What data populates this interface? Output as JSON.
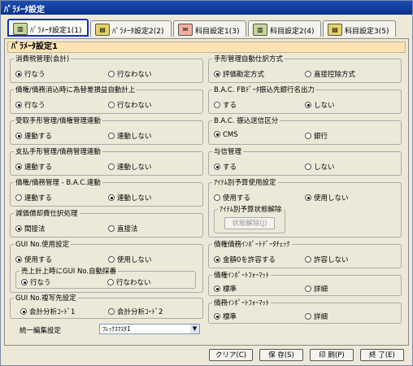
{
  "window": {
    "title": "ﾊﾟﾗﾒｰﾀ設定"
  },
  "tabs": [
    {
      "label": "ﾊﾟﾗﾒｰﾀ設定1(1)",
      "icon": "book-icon",
      "active": true
    },
    {
      "label": "ﾊﾟﾗﾒｰﾀ設定2(2)",
      "icon": "notebook-icon"
    },
    {
      "label": "科目設定1(3)",
      "icon": "envelope-icon"
    },
    {
      "label": "科目設定2(4)",
      "icon": "book-icon"
    },
    {
      "label": "科目設定3(5)",
      "icon": "notebook-icon"
    }
  ],
  "panel_title": "ﾊﾟﾗﾒｰﾀ設定1",
  "groups": {
    "g1": {
      "label": "消費税管理(会計)",
      "a": "行なう",
      "b": "行なわない",
      "selected": "a"
    },
    "g2": {
      "label": "債権/債務消込時に為替差損益自動計上",
      "a": "行なう",
      "b": "行なわない",
      "selected": "a"
    },
    "g3": {
      "label": "受取手形管理/債権管理連動",
      "a": "連動する",
      "b": "連動しない",
      "selected": "a"
    },
    "g4": {
      "label": "支払手形管理/債務管理連動",
      "a": "連動する",
      "b": "連動しない",
      "selected": "a"
    },
    "g5": {
      "label": "債権/債務管理 - B.A.C.連動",
      "a": "連動する",
      "b": "連動しない",
      "selected": "b"
    },
    "g6": {
      "label": "減価償却費仕訳処理",
      "a": "間接法",
      "b": "直接法",
      "selected": "a"
    },
    "g7": {
      "label": "GUI No.使用設定",
      "a": "使用する",
      "b": "使用しない",
      "selected": "a"
    },
    "g7s": {
      "label": "売上計上時にGUI No.自動採番",
      "a": "行なう",
      "b": "行なわない",
      "selected": "a"
    },
    "g8": {
      "label": "GUI No.複写先設定",
      "a": "会計分析ｺｰﾄﾞ1",
      "b": "会計分析ｺｰﾄﾞ2",
      "selected": "a"
    },
    "r1": {
      "label": "手形管理自動仕訳方式",
      "a": "評価勘定方式",
      "b": "直接控除方式",
      "selected": "a"
    },
    "r2": {
      "label": "B.A.C. FBﾃﾞｰﾀ振込先銀行名出力",
      "a": "する",
      "b": "しない",
      "selected": "b"
    },
    "r3": {
      "label": "B.A.C. 振込送信区分",
      "a": "CMS",
      "b": "銀行",
      "selected": "a"
    },
    "r4": {
      "label": "与信管理",
      "a": "する",
      "b": "しない",
      "selected": "a"
    },
    "r5": {
      "label": "ｱｲﾃﾑ別予算使用設定",
      "a": "使用する",
      "b": "使用しない",
      "selected": "b"
    },
    "r5s": {
      "label": "ｱｲﾃﾑ別予算状態解除",
      "button": "状態解除(J)"
    },
    "r6": {
      "label": "債権債務ｲﾝﾎﾟｰﾄﾃﾞｰﾀﾁｪｯｸ",
      "a": "金額0を許容する",
      "b": "許容しない",
      "selected": "a"
    },
    "r7": {
      "label": "債権ｲﾝﾎﾟｰﾄﾌｫｰﾏｯﾄ",
      "a": "標準",
      "b": "詳細",
      "selected": "a"
    },
    "r8": {
      "label": "債務ｲﾝﾎﾟｰﾄﾌｫｰﾏｯﾄ",
      "a": "標準",
      "b": "詳細",
      "selected": "a"
    }
  },
  "unified_edit": {
    "label": "統一編集設定",
    "value": "ﾌﾚｯｸｽﾏｽﾀ1"
  },
  "buttons": {
    "clear": "クリア(C)",
    "save": "保 存(S)",
    "print": "印 刷(P)",
    "exit": "終 了(E)"
  }
}
